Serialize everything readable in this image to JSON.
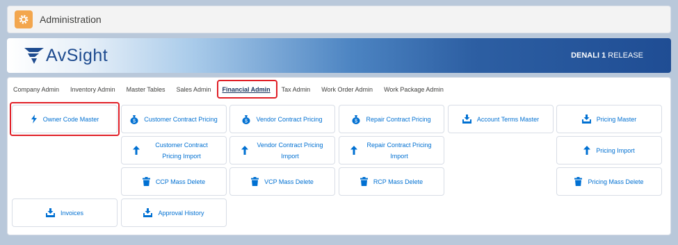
{
  "header": {
    "title": "Administration",
    "icon": "gear-icon"
  },
  "banner": {
    "brand": "AvSight",
    "release_bold": "DENALI 1",
    "release_rest": "RELEASE"
  },
  "tabs": [
    {
      "label": "Company Admin"
    },
    {
      "label": "Inventory Admin"
    },
    {
      "label": "Master Tables"
    },
    {
      "label": "Sales Admin"
    },
    {
      "label": "Financial Admin",
      "active": true
    },
    {
      "label": "Tax Admin"
    },
    {
      "label": "Work Order Admin"
    },
    {
      "label": "Work Package Admin"
    }
  ],
  "buttons": {
    "owner_code_master": "Owner Code Master",
    "customer_contract_pricing": "Customer Contract Pricing",
    "vendor_contract_pricing": "Vendor Contract Pricing",
    "repair_contract_pricing": "Repair Contract Pricing",
    "account_terms_master": "Account Terms Master",
    "pricing_master": "Pricing Master",
    "customer_contract_pricing_import": "Customer Contract Pricing Import",
    "vendor_contract_pricing_import": "Vendor Contract Pricing Import",
    "repair_contract_pricing_import": "Repair Contract Pricing Import",
    "pricing_import": "Pricing Import",
    "ccp_mass_delete": "CCP Mass Delete",
    "vcp_mass_delete": "VCP Mass Delete",
    "rcp_mass_delete": "RCP Mass Delete",
    "pricing_mass_delete": "Pricing Mass Delete",
    "invoices": "Invoices",
    "approval_history": "Approval History"
  },
  "colors": {
    "accent": "#0070d2",
    "highlight": "#e01e26",
    "header_icon_bg": "#f3a64d",
    "brand": "#1e4b8f"
  }
}
